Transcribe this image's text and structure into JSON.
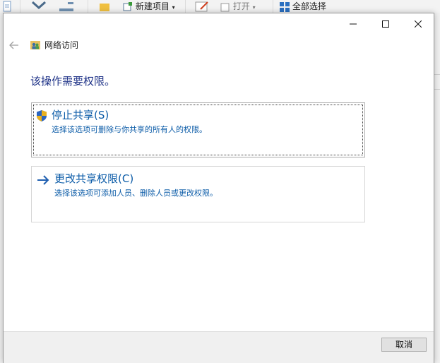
{
  "background_ribbon": {
    "new_item_label": "新建项目",
    "open_label": "打开",
    "select_all_label": "全部选择"
  },
  "dialog": {
    "nav_title": "网络访问",
    "heading": "该操作需要权限。",
    "options": [
      {
        "title": "停止共享(S)",
        "description": "选择该选项可删除与你共享的所有人的权限。",
        "icon": "uac-shield-icon"
      },
      {
        "title": "更改共享权限(C)",
        "description": "选择该选项可添加人员、删除人员或更改权限。",
        "icon": "arrow-right-icon"
      }
    ],
    "cancel_label": "取消"
  },
  "colors": {
    "heading": "#1e3287",
    "link": "#0c5ca8",
    "arrow": "#1f5fb0"
  }
}
